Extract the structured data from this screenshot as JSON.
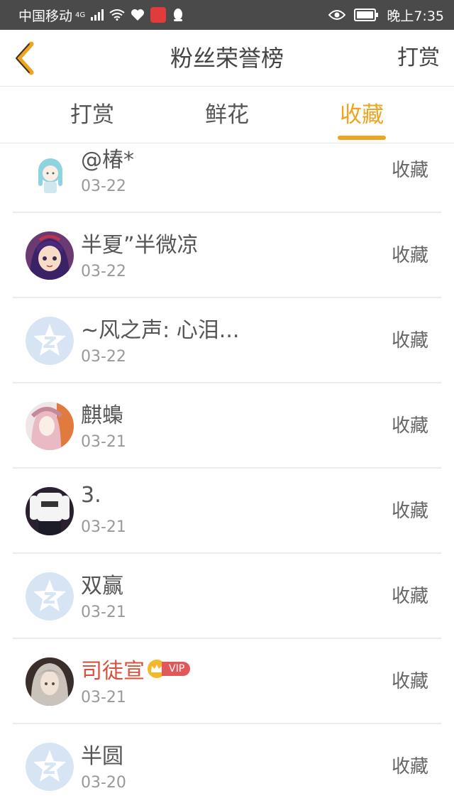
{
  "status_bar": {
    "carrier": "中国移动",
    "network": "4G",
    "time": "晚上7:35"
  },
  "header": {
    "title": "粉丝荣誉榜",
    "right_action": "打赏"
  },
  "tabs": [
    {
      "label": "打赏"
    },
    {
      "label": "鲜花"
    },
    {
      "label": "收藏"
    }
  ],
  "active_tab": "收藏",
  "colors": {
    "accent": "#f0a31e",
    "vip_name": "#d9513c"
  },
  "fans": [
    {
      "name": "@椿*",
      "date": "03-22",
      "action": "收藏",
      "avatar": "anime-girl-blue-hair"
    },
    {
      "name": "半夏”半微凉",
      "date": "03-22",
      "action": "收藏",
      "avatar": "anime-girl-purple"
    },
    {
      "name": "~风之声: 心泪...",
      "date": "03-22",
      "action": "收藏",
      "avatar": "default-star"
    },
    {
      "name": "麒蟂",
      "date": "03-21",
      "action": "收藏",
      "avatar": "anime-girl-pink"
    },
    {
      "name": "3.",
      "date": "03-21",
      "action": "收藏",
      "avatar": "person-shirt"
    },
    {
      "name": "双赢",
      "date": "03-21",
      "action": "收藏",
      "avatar": "default-star"
    },
    {
      "name": "司徒宣",
      "date": "03-21",
      "action": "收藏",
      "avatar": "anime-boy-grey",
      "vip": "VIP"
    },
    {
      "name": "半圆",
      "date": "03-20",
      "action": "收藏",
      "avatar": "default-star"
    }
  ]
}
